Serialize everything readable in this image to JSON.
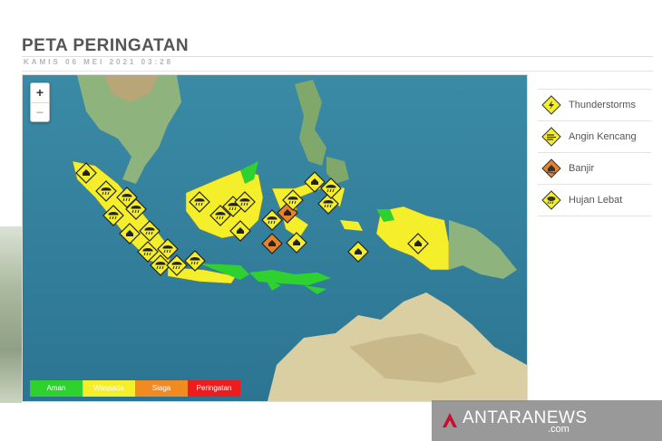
{
  "page": {
    "title": "PETA PERINGATAN",
    "timestamp": "KAMIS 06 MEI 2021 03:28"
  },
  "map": {
    "zoom_in": "+",
    "zoom_out": "−",
    "level_legend": [
      {
        "label": "Aman",
        "color": "#2fd12f"
      },
      {
        "label": "Waspada",
        "color": "#f5ee2a"
      },
      {
        "label": "Siaga",
        "color": "#f28a22"
      },
      {
        "label": "Peringatan",
        "color": "#ee1c1c"
      }
    ]
  },
  "legend": {
    "items": [
      {
        "label": "Thunderstorms",
        "icon": "thunderstorm-icon"
      },
      {
        "label": "Angin Kencang",
        "icon": "strong-wind-icon"
      },
      {
        "label": "Banjir",
        "icon": "flood-icon"
      },
      {
        "label": "Hujan Lebat",
        "icon": "heavy-rain-icon"
      }
    ]
  },
  "colors": {
    "waspada": "#f5ee2a",
    "siaga": "#e8812a",
    "aman": "#2fd12f",
    "sea": "#2f7f9c"
  },
  "watermark": {
    "brand": "ANTARANEWS",
    "domain": ".com"
  }
}
